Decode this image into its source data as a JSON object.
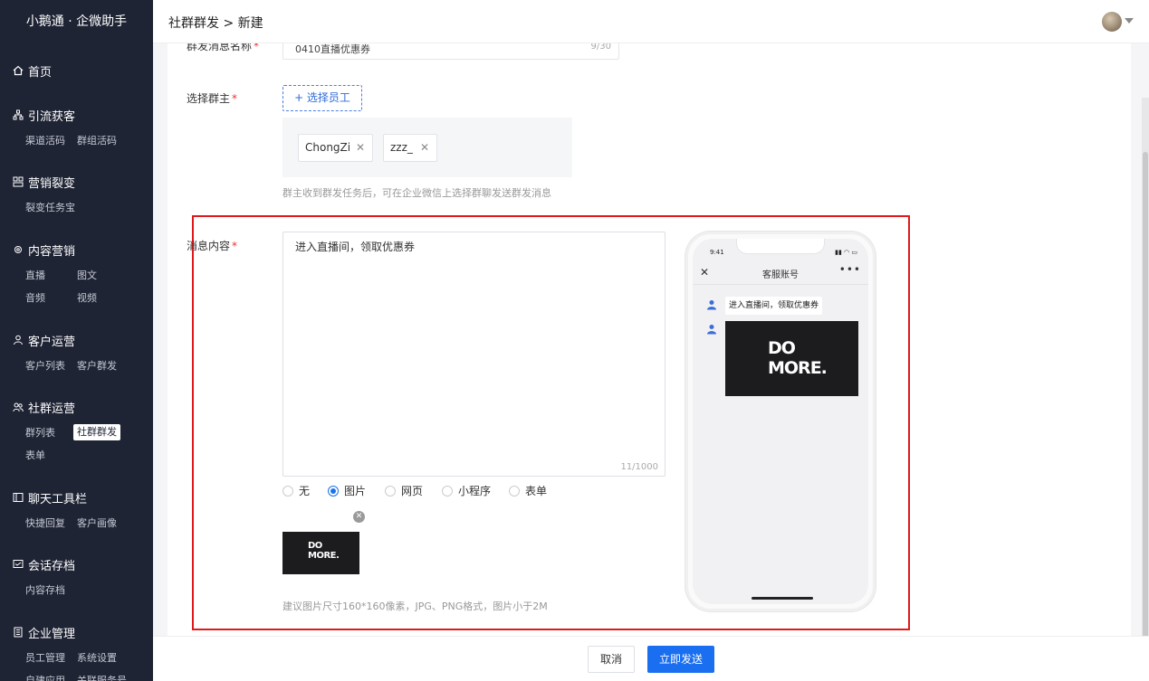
{
  "sidebar": {
    "brand": "小鹅通 · 企微助手",
    "groups": [
      {
        "title": "首页",
        "icon": "home-icon",
        "items": []
      },
      {
        "title": "引流获客",
        "icon": "org-icon",
        "items": [
          "渠道活码",
          "群组活码"
        ]
      },
      {
        "title": "营销裂变",
        "icon": "grid-icon",
        "items": [
          "裂变任务宝"
        ]
      },
      {
        "title": "内容营销",
        "icon": "gear-icon",
        "items": [
          "直播",
          "图文",
          "音频",
          "视频"
        ]
      },
      {
        "title": "客户运营",
        "icon": "person-icon",
        "items": [
          "客户列表",
          "客户群发"
        ]
      },
      {
        "title": "社群运营",
        "icon": "group-icon",
        "items": [
          "群列表",
          "社群群发",
          "表单"
        ]
      },
      {
        "title": "聊天工具栏",
        "icon": "toolbar-icon",
        "items": [
          "快捷回复",
          "客户画像"
        ]
      },
      {
        "title": "会话存档",
        "icon": "archive-icon",
        "items": [
          "内容存档"
        ]
      },
      {
        "title": "企业管理",
        "icon": "building-icon",
        "items": [
          "员工管理",
          "系统设置",
          "自建应用",
          "关联服务号"
        ]
      }
    ],
    "active_item": "社群群发"
  },
  "header": {
    "breadcrumb": "社群群发 > 新建"
  },
  "form": {
    "name_label": "群发消息名称",
    "name_value": "0410直播优惠券",
    "name_count": "9/30",
    "owner_label": "选择群主",
    "select_button": "+ 选择员工",
    "owners": [
      "ChongZi",
      "zzz_"
    ],
    "owner_hint": "群主收到群发任务后，可在企业微信上选择群聊发送群发消息",
    "content_label": "消息内容",
    "content_value": "进入直播间，领取优惠券",
    "content_count": "11/1000",
    "attach_types": [
      "无",
      "图片",
      "网页",
      "小程序",
      "表单"
    ],
    "attach_selected": "图片",
    "image_text_line1": "DO",
    "image_text_line2": "MORE.",
    "image_hint": "建议图片尺寸160*160像素，JPG、PNG格式，图片小于2M"
  },
  "preview": {
    "time": "9:41",
    "title": "客服账号",
    "message": "进入直播间，领取优惠券"
  },
  "footer": {
    "cancel": "取消",
    "send": "立即发送"
  },
  "colors": {
    "sidebar_bg": "#1f2435",
    "primary": "#1a6ff0",
    "highlight_frame": "#e0191c"
  }
}
